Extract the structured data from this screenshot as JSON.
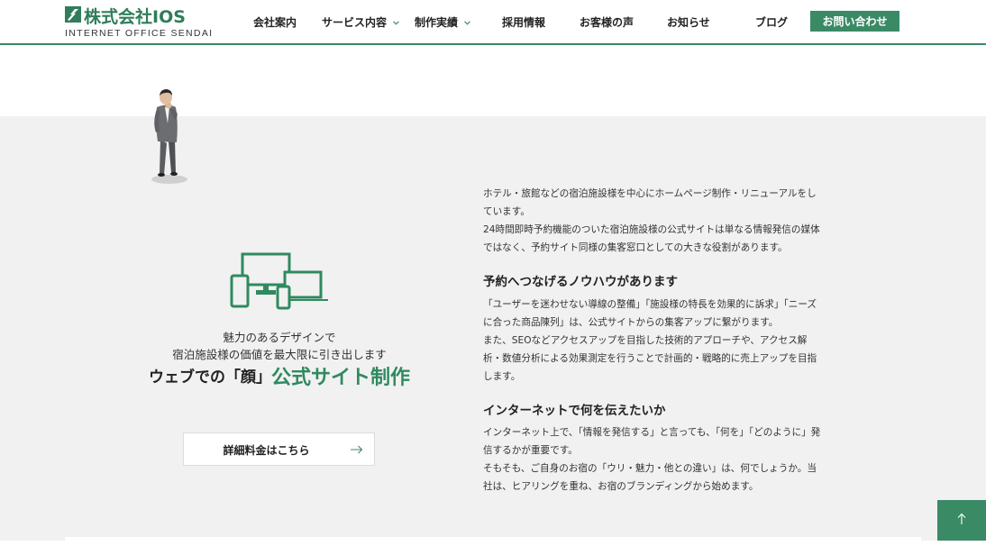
{
  "logo": {
    "name": "株式会社IOS",
    "subtitle": "INTERNET OFFICE SENDAI"
  },
  "nav": {
    "items": [
      {
        "label": "会社案内",
        "has_dropdown": false
      },
      {
        "label": "サービス内容",
        "has_dropdown": true
      },
      {
        "label": "制作実績",
        "has_dropdown": true
      },
      {
        "label": "採用情報",
        "has_dropdown": false
      },
      {
        "label": "お客様の声",
        "has_dropdown": false
      },
      {
        "label": "お知らせ",
        "has_dropdown": false
      },
      {
        "label": "ブログ",
        "has_dropdown": false
      }
    ],
    "contact_label": "お問い合わせ"
  },
  "hero": {
    "tagline_1": "魅力のあるデザインで",
    "tagline_2": "宿泊施設様の価値を最大限に引き出します",
    "headline_prefix": "ウェブでの「顔」",
    "headline_main": "公式サイト制作",
    "price_button": "詳細料金はこちら"
  },
  "content": {
    "intro": [
      "ホテル・旅館などの宿泊施設様を中心にホームページ制作・リニューアルをし",
      "ています。",
      "24時間即時予約機能のついた宿泊施設様の公式サイトは単なる情報発信の媒体",
      "ではなく、予約サイト同様の集客窓口としての大きな役割があります。"
    ],
    "heading_1": "予約へつなげるノウハウがあります",
    "body_1": [
      "「ユーザーを迷わせない導線の整備」「施設様の特長を効果的に訴求」「ニーズ",
      "に合った商品陳列」は、公式サイトからの集客アップに繋がります。",
      "また、SEOなどアクセスアップを目指した技術的アプローチや、アクセス解",
      "析・数値分析による効果測定を行うことで計画的・戦略的に売上アップを目指",
      "します。"
    ],
    "heading_2": "インターネットで何を伝えたいか",
    "body_2": [
      "インターネット上で、「情報を発信する」と言っても、「何を」「どのように」発",
      "信するかが重要です。",
      "そもそも、ご自身のお宿の「ウリ・魅力・他との違い」は、何でしょうか。当",
      "社は、ヒアリングを重ね、お宿のブランディングから始めます。"
    ]
  },
  "colors": {
    "brand_green": "#3a8a66",
    "headline_green": "#2f8a5f",
    "section_bg": "#f1f1f1"
  },
  "icons": [
    "logo-mark-icon",
    "chevron-down-icon",
    "devices-icon",
    "arrow-right-icon",
    "arrow-up-icon"
  ]
}
